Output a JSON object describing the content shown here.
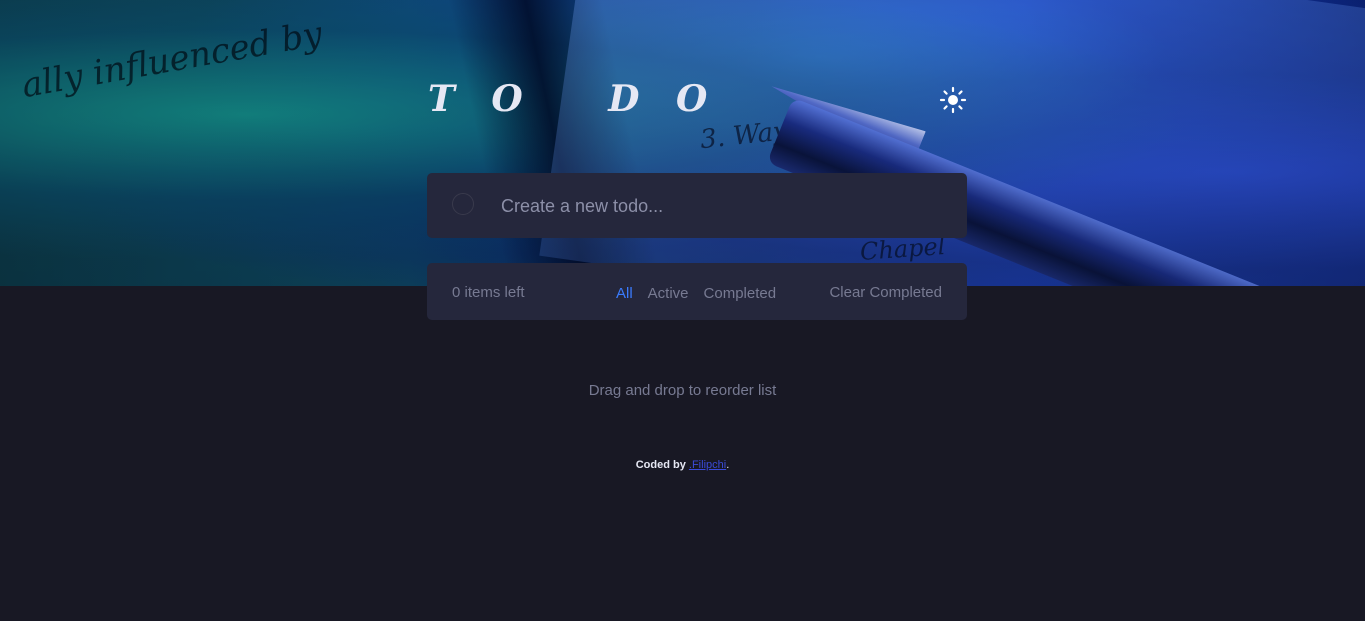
{
  "header": {
    "title": "T O   D O",
    "theme_toggle_icon": "sun-icon"
  },
  "new_todo": {
    "placeholder": "Create a new todo...",
    "value": ""
  },
  "footer_bar": {
    "items_left": "0 items left",
    "filters": [
      {
        "label": "All",
        "active": true
      },
      {
        "label": "Active",
        "active": false
      },
      {
        "label": "Completed",
        "active": false
      }
    ],
    "clear_label": "Clear Completed"
  },
  "hint": "Drag and drop to reorder list",
  "credit": {
    "prefix": "Coded by ",
    "link_text": ".Filipchi",
    "suffix": "."
  },
  "colors": {
    "background": "#181824",
    "card": "#25273c",
    "accent": "#3a7bfd",
    "muted_text": "#777a92",
    "title_text": "#e6e8f4"
  }
}
